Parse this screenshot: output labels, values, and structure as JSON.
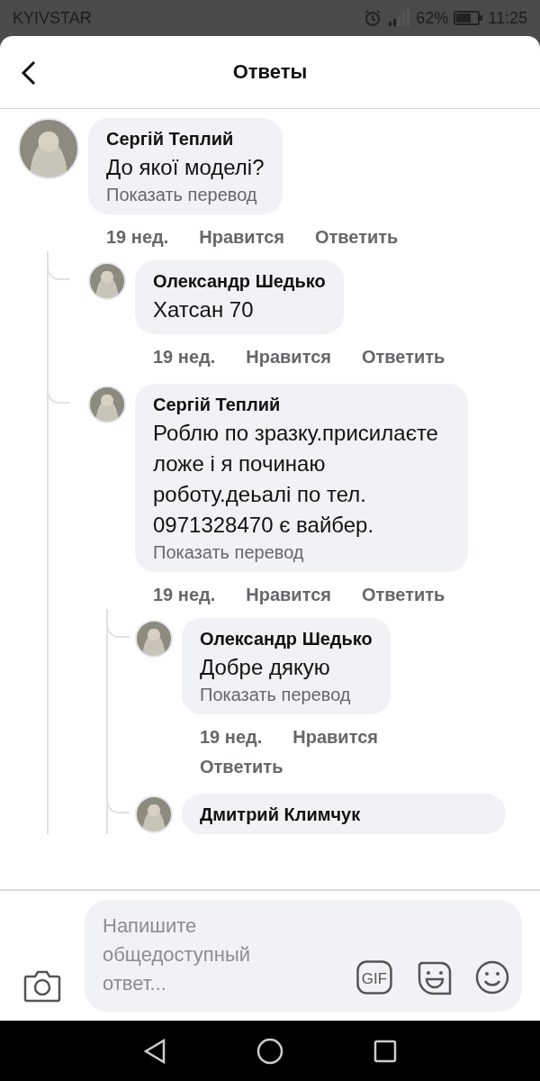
{
  "status_bar": {
    "carrier": "KYIVSTAR",
    "battery": "62%",
    "time": "11:25"
  },
  "header": {
    "title": "Ответы"
  },
  "comments": [
    {
      "author": "Сергій Теплий",
      "text": "До якої моделі?",
      "translate": "Показать перевод",
      "time": "19 нед.",
      "like": "Нравится",
      "reply": "Ответить",
      "children": [
        {
          "author": "Олександр Шедько",
          "text": "Хатсан 70",
          "time": "19 нед.",
          "like": "Нравится",
          "reply": "Ответить"
        },
        {
          "author": "Сергій Теплий",
          "text": "Роблю по зразку.присилаєте ложе і я починаю роботу.деьалі по тел. 0971328470 є вайбер.",
          "translate": "Показать перевод",
          "time": "19 нед.",
          "like": "Нравится",
          "reply": "Ответить",
          "children": [
            {
              "author": "Олександр Шедько",
              "text": "Добре дякую",
              "translate": "Показать перевод",
              "time": "19 нед.",
              "like": "Нравится",
              "reply": "Ответить"
            },
            {
              "author": "Дмитрий Климчук"
            }
          ]
        }
      ]
    }
  ],
  "composer": {
    "placeholder": "Напишите общедоступный ответ...",
    "gif_label": "GIF"
  }
}
